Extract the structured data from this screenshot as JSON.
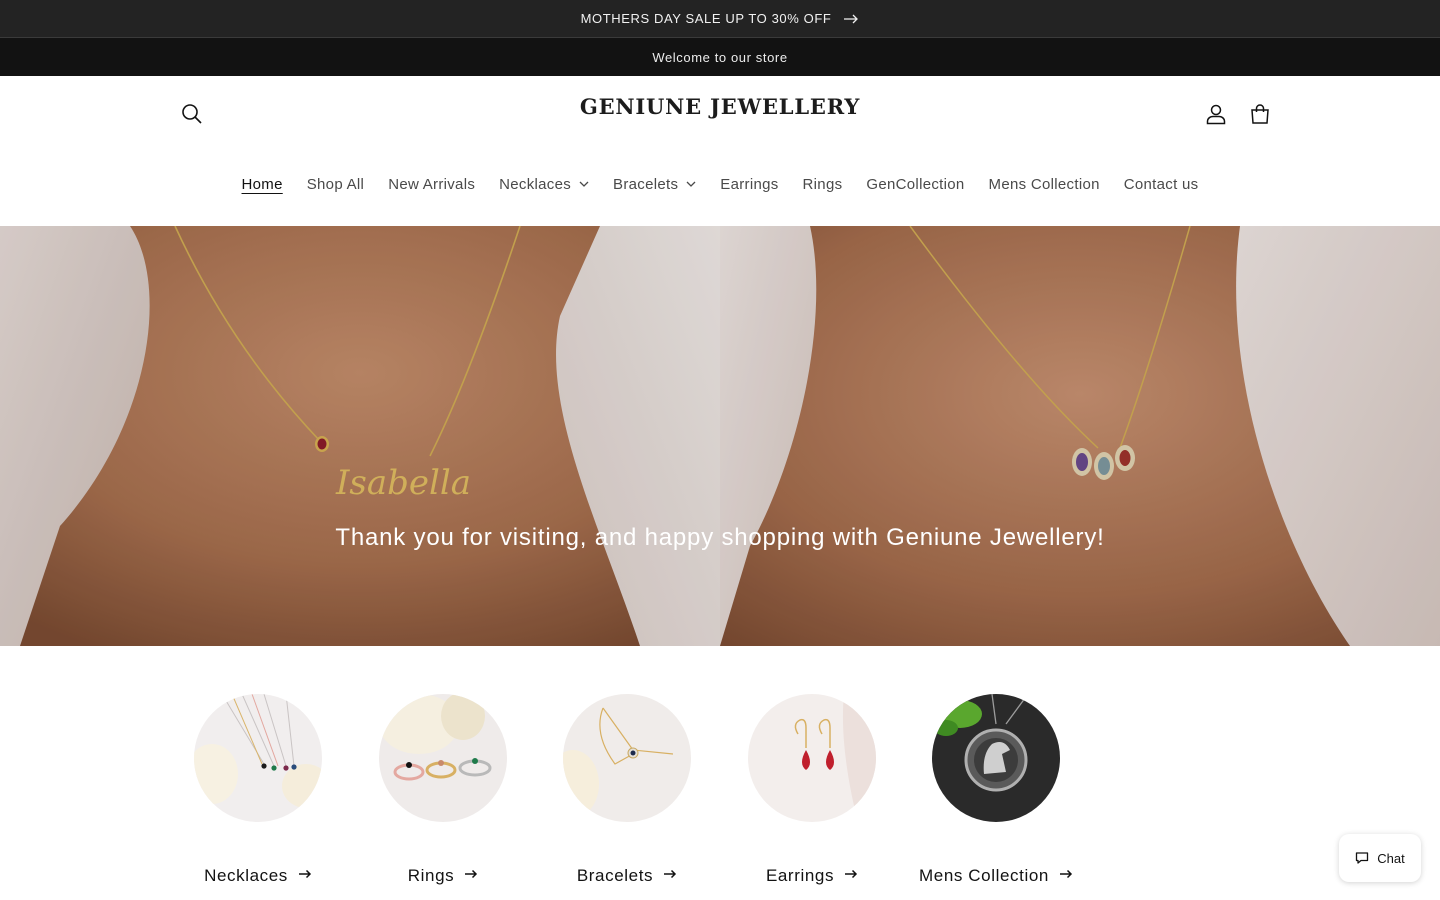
{
  "announcement": {
    "sale_text": "MOTHERS DAY SALE UP TO 30% OFF",
    "sale_icon": "arrow-right-icon",
    "welcome_text": "Welcome to our store"
  },
  "header": {
    "logo": "GENIUNE JEWELLERY",
    "icons": [
      "search-icon",
      "account-icon",
      "cart-icon"
    ]
  },
  "nav": {
    "items": [
      {
        "label": "Home",
        "active": true
      },
      {
        "label": "Shop All"
      },
      {
        "label": "New Arrivals"
      },
      {
        "label": "Necklaces",
        "dropdown": true
      },
      {
        "label": "Bracelets",
        "dropdown": true
      },
      {
        "label": "Earrings"
      },
      {
        "label": "Rings"
      },
      {
        "label": "GenCollection"
      },
      {
        "label": "Mens Collection"
      },
      {
        "label": "Contact us"
      }
    ]
  },
  "hero": {
    "tagline": "Thank you for visiting, and happy shopping with Geniune Jewellery!",
    "left_pendant_text": "Isabella"
  },
  "collections": [
    {
      "label": "Necklaces"
    },
    {
      "label": "Rings"
    },
    {
      "label": "Bracelets"
    },
    {
      "label": "Earrings"
    },
    {
      "label": "Mens Collection"
    }
  ],
  "chat": {
    "label": "Chat",
    "icon": "chat-icon"
  },
  "colors": {
    "announcement_bg": "#232323",
    "welcome_bg": "#121212",
    "text": "#121212",
    "nav_text": "#4a4a4a"
  }
}
